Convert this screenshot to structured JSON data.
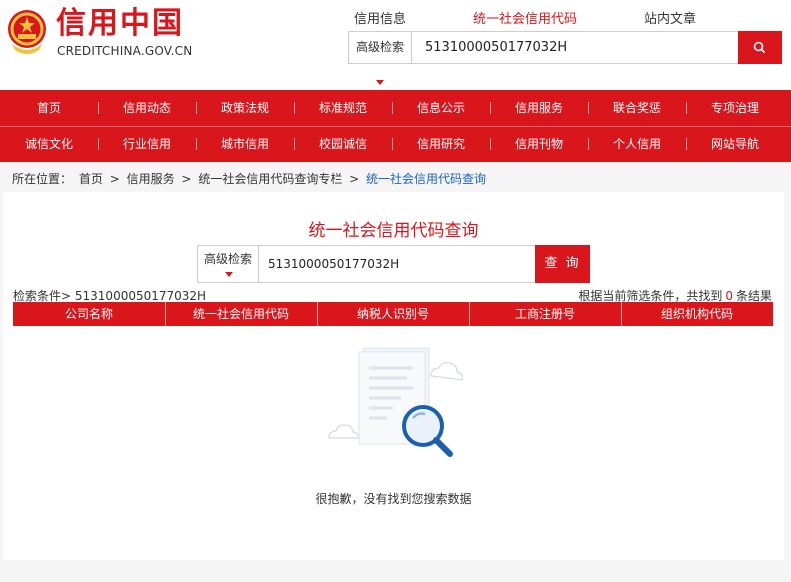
{
  "header": {
    "logo_cn": "信用中国",
    "logo_en": "CREDITCHINA.GOV.CN",
    "tabs": [
      "信用信息",
      "统一社会信用代码",
      "站内文章"
    ],
    "search": {
      "advanced_label": "高级检索",
      "value": "5131000050177032H"
    }
  },
  "nav": {
    "row1": [
      "首页",
      "信用动态",
      "政策法规",
      "标准规范",
      "信息公示",
      "信用服务",
      "联合奖惩",
      "专项治理"
    ],
    "row2": [
      "诚信文化",
      "行业信用",
      "城市信用",
      "校园诚信",
      "信用研究",
      "信用刊物",
      "个人信用",
      "网站导航"
    ]
  },
  "breadcrumb": {
    "label": "所在位置：",
    "items": [
      "首页",
      ">",
      "信用服务",
      ">",
      "统一社会信用代码查询专栏",
      ">"
    ],
    "current": "统一社会信用代码查询"
  },
  "main": {
    "title": "统一社会信用代码查询",
    "advanced_label": "高级检索",
    "query_value": "5131000050177032H",
    "query_button": "查 询",
    "condition_label": "检索条件>",
    "condition_value": "5131000050177032H",
    "result_prefix": "根据当前筛选条件，共找到",
    "result_count": "0",
    "result_suffix": "条结果",
    "columns": [
      "公司名称",
      "统一社会信用代码",
      "纳税人识别号",
      "工商注册号",
      "组织机构代码"
    ],
    "empty_message": "很抱歉，没有找到您搜索数据"
  },
  "colors": {
    "brand_red": "#d9161c",
    "link_blue": "#1a63c7"
  },
  "icons": {
    "emblem": "national-emblem-icon",
    "search": "search-icon",
    "caret": "caret-down-icon",
    "empty": "empty-search-illustration"
  }
}
